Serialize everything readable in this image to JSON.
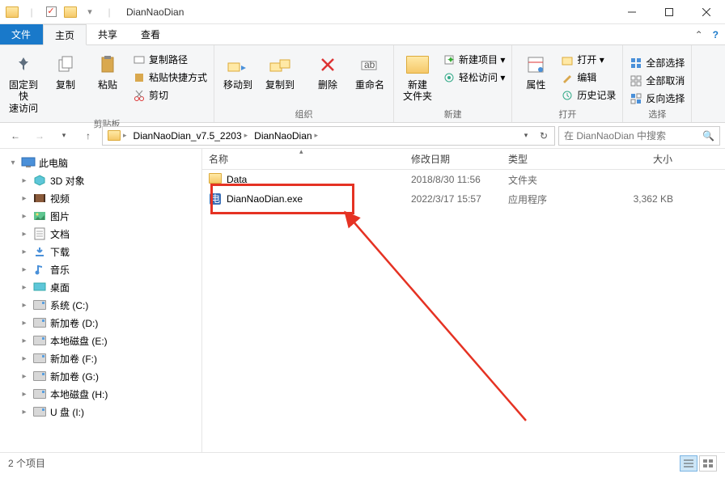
{
  "title": "DianNaoDian",
  "tabs": {
    "file": "文件",
    "home": "主页",
    "share": "共享",
    "view": "查看"
  },
  "ribbon": {
    "pin": "固定到快\n速访问",
    "copy": "复制",
    "paste": "粘贴",
    "copypath": "复制路径",
    "pasteshortcut": "粘贴快捷方式",
    "cut": "剪切",
    "group_clip": "剪贴板",
    "moveto": "移动到",
    "copyto": "复制到",
    "delete": "删除",
    "rename": "重命名",
    "group_org": "组织",
    "newfolder": "新建\n文件夹",
    "newitem": "新建项目 ▾",
    "easyaccess": "轻松访问 ▾",
    "group_new": "新建",
    "properties": "属性",
    "open": "打开 ▾",
    "edit": "编辑",
    "history": "历史记录",
    "group_open": "打开",
    "selectall": "全部选择",
    "selectnone": "全部取消",
    "invert": "反向选择",
    "group_select": "选择"
  },
  "breadcrumbs": [
    "DianNaoDian_v7.5_2203",
    "DianNaoDian"
  ],
  "search_placeholder": "在 DianNaoDian 中搜索",
  "cols": {
    "name": "名称",
    "date": "修改日期",
    "type": "类型",
    "size": "大小"
  },
  "files": [
    {
      "name": "Data",
      "date": "2018/8/30 11:56",
      "type": "文件夹",
      "size": ""
    },
    {
      "name": "DianNaoDian.exe",
      "date": "2022/3/17 15:57",
      "type": "应用程序",
      "size": "3,362 KB"
    }
  ],
  "tree": [
    {
      "label": "此电脑",
      "chev": "▾",
      "icon": "pc"
    },
    {
      "label": "3D 对象",
      "chev": "▸",
      "icon": "3d",
      "indent": 1
    },
    {
      "label": "视频",
      "chev": "▸",
      "icon": "video",
      "indent": 1
    },
    {
      "label": "图片",
      "chev": "▸",
      "icon": "pic",
      "indent": 1
    },
    {
      "label": "文档",
      "chev": "▸",
      "icon": "doc",
      "indent": 1
    },
    {
      "label": "下载",
      "chev": "▸",
      "icon": "dl",
      "indent": 1
    },
    {
      "label": "音乐",
      "chev": "▸",
      "icon": "music",
      "indent": 1
    },
    {
      "label": "桌面",
      "chev": "▸",
      "icon": "desk",
      "indent": 1
    },
    {
      "label": "系统 (C:)",
      "chev": "▸",
      "icon": "drive",
      "indent": 1
    },
    {
      "label": "新加卷 (D:)",
      "chev": "▸",
      "icon": "drive",
      "indent": 1
    },
    {
      "label": "本地磁盘 (E:)",
      "chev": "▸",
      "icon": "drive",
      "indent": 1
    },
    {
      "label": "新加卷 (F:)",
      "chev": "▸",
      "icon": "drive",
      "indent": 1
    },
    {
      "label": "新加卷 (G:)",
      "chev": "▸",
      "icon": "drive",
      "indent": 1
    },
    {
      "label": "本地磁盘 (H:)",
      "chev": "▸",
      "icon": "drive",
      "indent": 1
    },
    {
      "label": "U 盘 (I:)",
      "chev": "▸",
      "icon": "drive",
      "indent": 1
    }
  ],
  "status": "2 个项目"
}
